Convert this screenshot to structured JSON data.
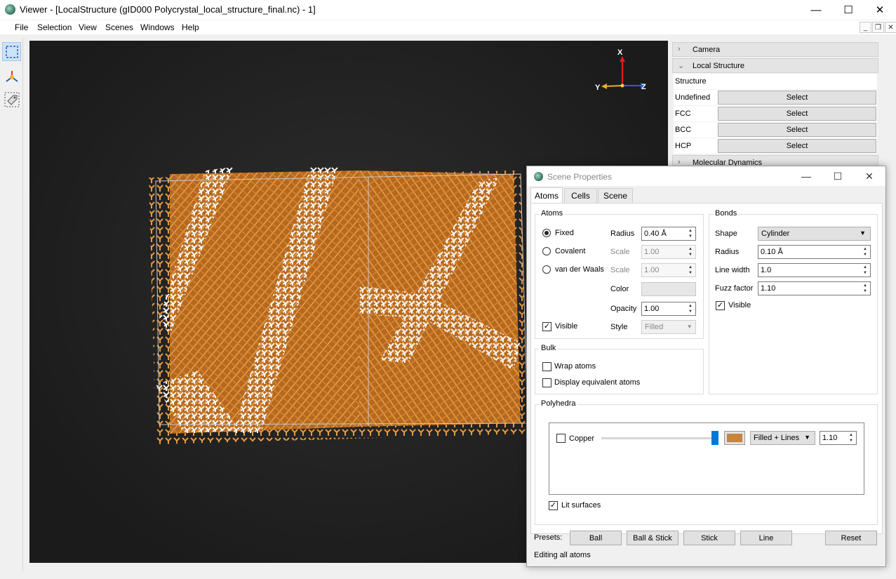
{
  "window": {
    "title": "Viewer - [LocalStructure (gID000 Polycrystal_local_structure_final.nc) - 1]",
    "minimize": "—",
    "maximize": "☐",
    "close": "✕"
  },
  "menu": [
    "File",
    "Selection",
    "View",
    "Scenes",
    "Windows",
    "Help"
  ],
  "viewport": {
    "axes": {
      "x": "X",
      "y": "Y",
      "z": "Z"
    }
  },
  "panel": {
    "sections": {
      "camera": "Camera",
      "local_structure": "Local Structure",
      "molecular_dynamics": "Molecular Dynamics"
    },
    "header": "Structure",
    "rows": [
      {
        "label": "Undefined",
        "button": "Select"
      },
      {
        "label": "FCC",
        "button": "Select"
      },
      {
        "label": "BCC",
        "button": "Select"
      },
      {
        "label": "HCP",
        "button": "Select"
      }
    ]
  },
  "dialog": {
    "title": "Scene Properties",
    "tabs": [
      "Atoms",
      "Cells",
      "Scene"
    ],
    "atoms": {
      "group": "Atoms",
      "fixed": "Fixed",
      "covalent": "Covalent",
      "vdw": "van der Waals",
      "radius_label": "Radius",
      "radius_value": "0.40 Å",
      "scale_label": "Scale",
      "scale_value": "1.00",
      "color_label": "Color",
      "opacity_label": "Opacity",
      "opacity_value": "1.00",
      "visible": "Visible",
      "style_label": "Style",
      "style_value": "Filled"
    },
    "bonds": {
      "group": "Bonds",
      "shape_label": "Shape",
      "shape_value": "Cylinder",
      "radius_label": "Radius",
      "radius_value": "0.10 Å",
      "linewidth_label": "Line width",
      "linewidth_value": "1.0",
      "fuzz_label": "Fuzz factor",
      "fuzz_value": "1.10",
      "visible": "Visible"
    },
    "bulk": {
      "group": "Bulk",
      "wrap": "Wrap atoms",
      "equiv": "Display equivalent atoms"
    },
    "polyhedra": {
      "group": "Polyhedra",
      "element": "Copper",
      "color": "#c8843a",
      "mode": "Filled + Lines",
      "value": "1.10",
      "lit": "Lit surfaces"
    },
    "presets": {
      "label": "Presets:",
      "buttons": [
        "Ball",
        "Ball & Stick",
        "Stick",
        "Line"
      ],
      "reset": "Reset"
    },
    "status": "Editing all atoms"
  },
  "colors": {
    "atom_cu": "#e0963f",
    "atom_white": "#f0f0f0"
  }
}
